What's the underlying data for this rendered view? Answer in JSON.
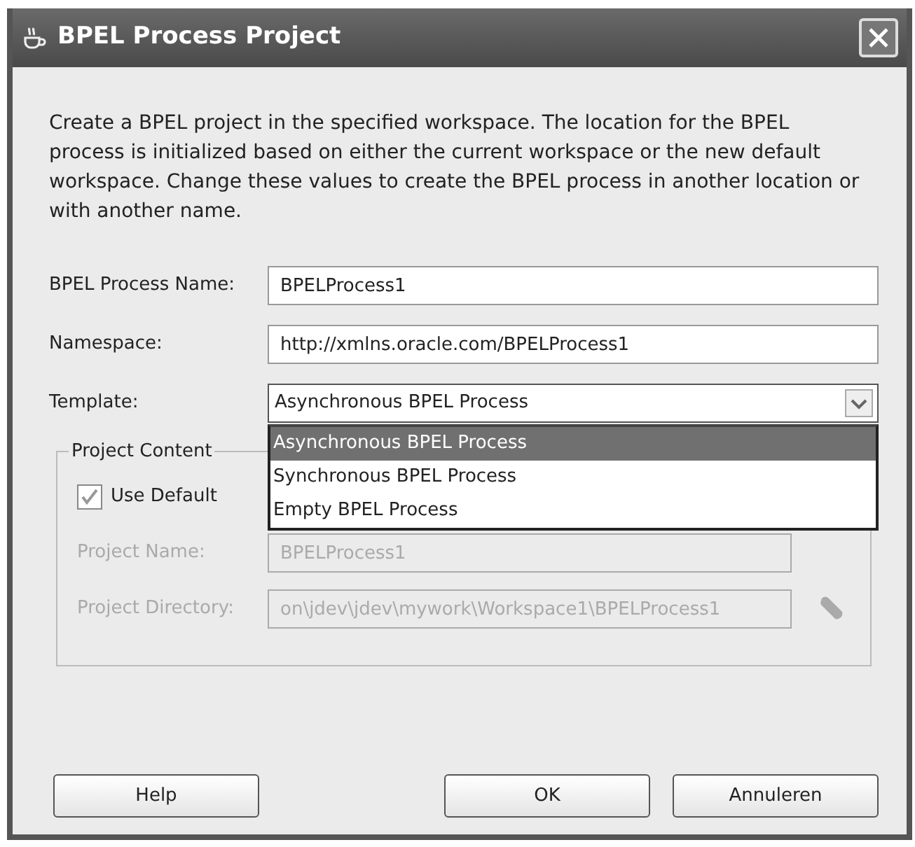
{
  "window": {
    "title": "BPEL Process Project"
  },
  "description": "Create a BPEL project in the specified workspace. The location for the BPEL process is initialized based on either the current workspace or the new default workspace. Change these values to create the BPEL process in another location or with another name.",
  "fields": [
    {
      "label": "BPEL Process Name:",
      "value": "BPELProcess1"
    },
    {
      "label": "Namespace:",
      "value": "http://xmlns.oracle.com/BPELProcess1"
    }
  ],
  "template": {
    "label": "Template:",
    "value": "Asynchronous BPEL Process",
    "expanded": true,
    "options": [
      {
        "label": "Asynchronous BPEL Process",
        "selected": true
      },
      {
        "label": "Synchronous BPEL Process",
        "selected": false
      },
      {
        "label": "Empty BPEL Process",
        "selected": false
      }
    ]
  },
  "project_content": {
    "title": "Project Content",
    "use_default": {
      "label": "Use Default",
      "checked": true
    },
    "fields": [
      {
        "label": "Project Name:",
        "value": "BPELProcess1",
        "disabled": true,
        "kind": "plain"
      },
      {
        "label": "Project Directory:",
        "value": "on\\jdev\\jdev\\mywork\\Workspace1\\BPELProcess1",
        "disabled": true,
        "kind": "browse"
      }
    ]
  },
  "buttons": [
    "Help",
    "OK",
    "Annuleren"
  ]
}
